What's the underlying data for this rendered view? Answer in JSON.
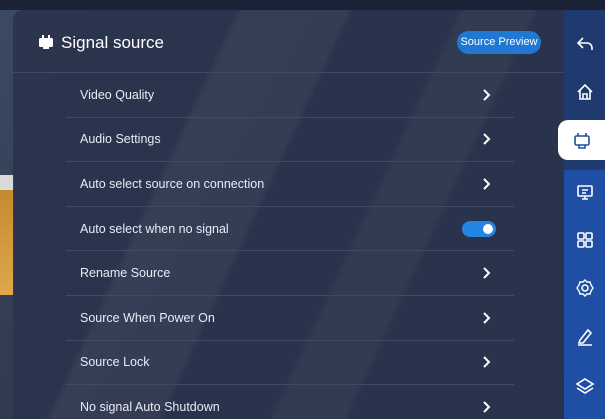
{
  "panel": {
    "title": "Signal source",
    "header_icon": "signal-source-icon",
    "preview_button_label": "Source Preview"
  },
  "settings": [
    {
      "label": "Video Quality",
      "control": "chevron"
    },
    {
      "label": "Audio Settings",
      "control": "chevron"
    },
    {
      "label": "Auto select source on connection",
      "control": "chevron"
    },
    {
      "label": "Auto select when no signal",
      "control": "toggle",
      "on": true
    },
    {
      "label": "Rename Source",
      "control": "chevron"
    },
    {
      "label": "Source When Power On",
      "control": "chevron"
    },
    {
      "label": "Source Lock",
      "control": "chevron"
    },
    {
      "label": "No signal Auto Shutdown",
      "control": "chevron"
    }
  ],
  "sidebar": {
    "items": [
      {
        "icon": "back-icon"
      },
      {
        "icon": "home-icon"
      },
      {
        "icon": "signal-source-icon",
        "active": true
      },
      {
        "icon": "screen-icon"
      },
      {
        "icon": "apps-grid-icon"
      },
      {
        "icon": "settings-gear-icon"
      },
      {
        "icon": "pen-icon"
      },
      {
        "icon": "layers-icon"
      }
    ]
  },
  "colors": {
    "accent": "#1f78d1",
    "toggle_on": "#2484e4",
    "sidebar": "#1e4fa5",
    "panel": "#2a344c"
  }
}
